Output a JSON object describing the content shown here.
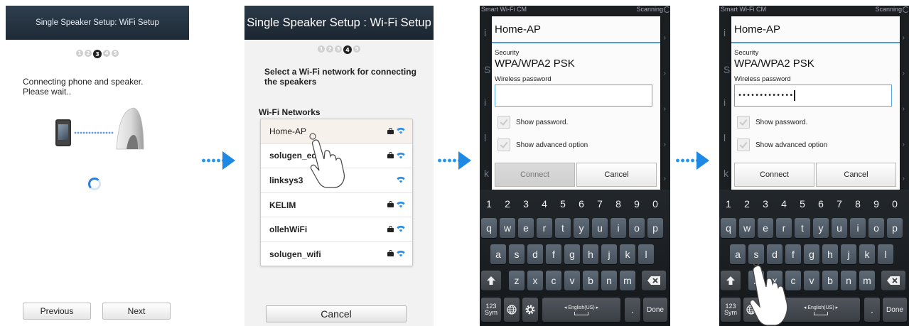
{
  "screen1": {
    "header": "Single Speaker Setup: WiFi Setup",
    "steps": [
      "1",
      "2",
      "3",
      "4",
      "5"
    ],
    "active_step": 3,
    "message": "Connecting phone and speaker.\nPlease wait..",
    "previous_label": "Previous",
    "next_label": "Next"
  },
  "screen2": {
    "header": "Single Speaker Setup : Wi-Fi Setup",
    "steps": [
      "1",
      "2",
      "3",
      "4",
      "5"
    ],
    "active_step": 4,
    "instruction": "Select a Wi-Fi network for connecting the speakers",
    "section_label": "Wi-Fi Networks",
    "networks": [
      {
        "name": "Home-AP",
        "locked": true,
        "selected": true
      },
      {
        "name": "solugen_edu",
        "locked": true,
        "selected": false
      },
      {
        "name": "linksys3",
        "locked": false,
        "selected": false
      },
      {
        "name": "KELIM",
        "locked": true,
        "selected": false
      },
      {
        "name": "ollehWiFi",
        "locked": true,
        "selected": false
      },
      {
        "name": "solugen_wifi",
        "locked": true,
        "selected": false
      }
    ],
    "cancel_label": "Cancel"
  },
  "screen3": {
    "bg_title": "Smart Wi-Fi CM",
    "bg_status": "Scanning",
    "dialog_title": "Home-AP",
    "security_label": "Security",
    "security_value": "WPA/WPA2 PSK",
    "password_label": "Wireless password",
    "password_value": "",
    "show_password_label": "Show password.",
    "advanced_label": "Show advanced option",
    "connect_label": "Connect",
    "cancel_label": "Cancel",
    "connect_enabled": false
  },
  "screen4": {
    "bg_title": "Smart Wi-Fi CM",
    "bg_status": "Scanning",
    "dialog_title": "Home-AP",
    "security_label": "Security",
    "security_value": "WPA/WPA2 PSK",
    "password_label": "Wireless password",
    "password_value": "•••••••••••••",
    "show_password_label": "Show password.",
    "advanced_label": "Show advanced option",
    "connect_label": "Connect",
    "cancel_label": "Cancel",
    "connect_enabled": true
  },
  "keyboard": {
    "row_numbers": [
      "1",
      "2",
      "3",
      "4",
      "5",
      "6",
      "7",
      "8",
      "9",
      "0"
    ],
    "row1": [
      "q",
      "w",
      "e",
      "r",
      "t",
      "y",
      "u",
      "i",
      "o",
      "p"
    ],
    "row2": [
      "a",
      "s",
      "d",
      "f",
      "g",
      "h",
      "j",
      "k",
      "l"
    ],
    "row3": [
      "z",
      "x",
      "c",
      "v",
      "b",
      "n",
      "m"
    ],
    "sym_label": "123\nSym",
    "language_label": "◂ English(US) ▸",
    "period_label": ".",
    "done_label": "Done"
  },
  "colors": {
    "arrow": "#1e88e5",
    "wifi_icon": "#2b8fe6",
    "field_focus": "#5aa5de",
    "header_dark": "#1e2a36"
  }
}
